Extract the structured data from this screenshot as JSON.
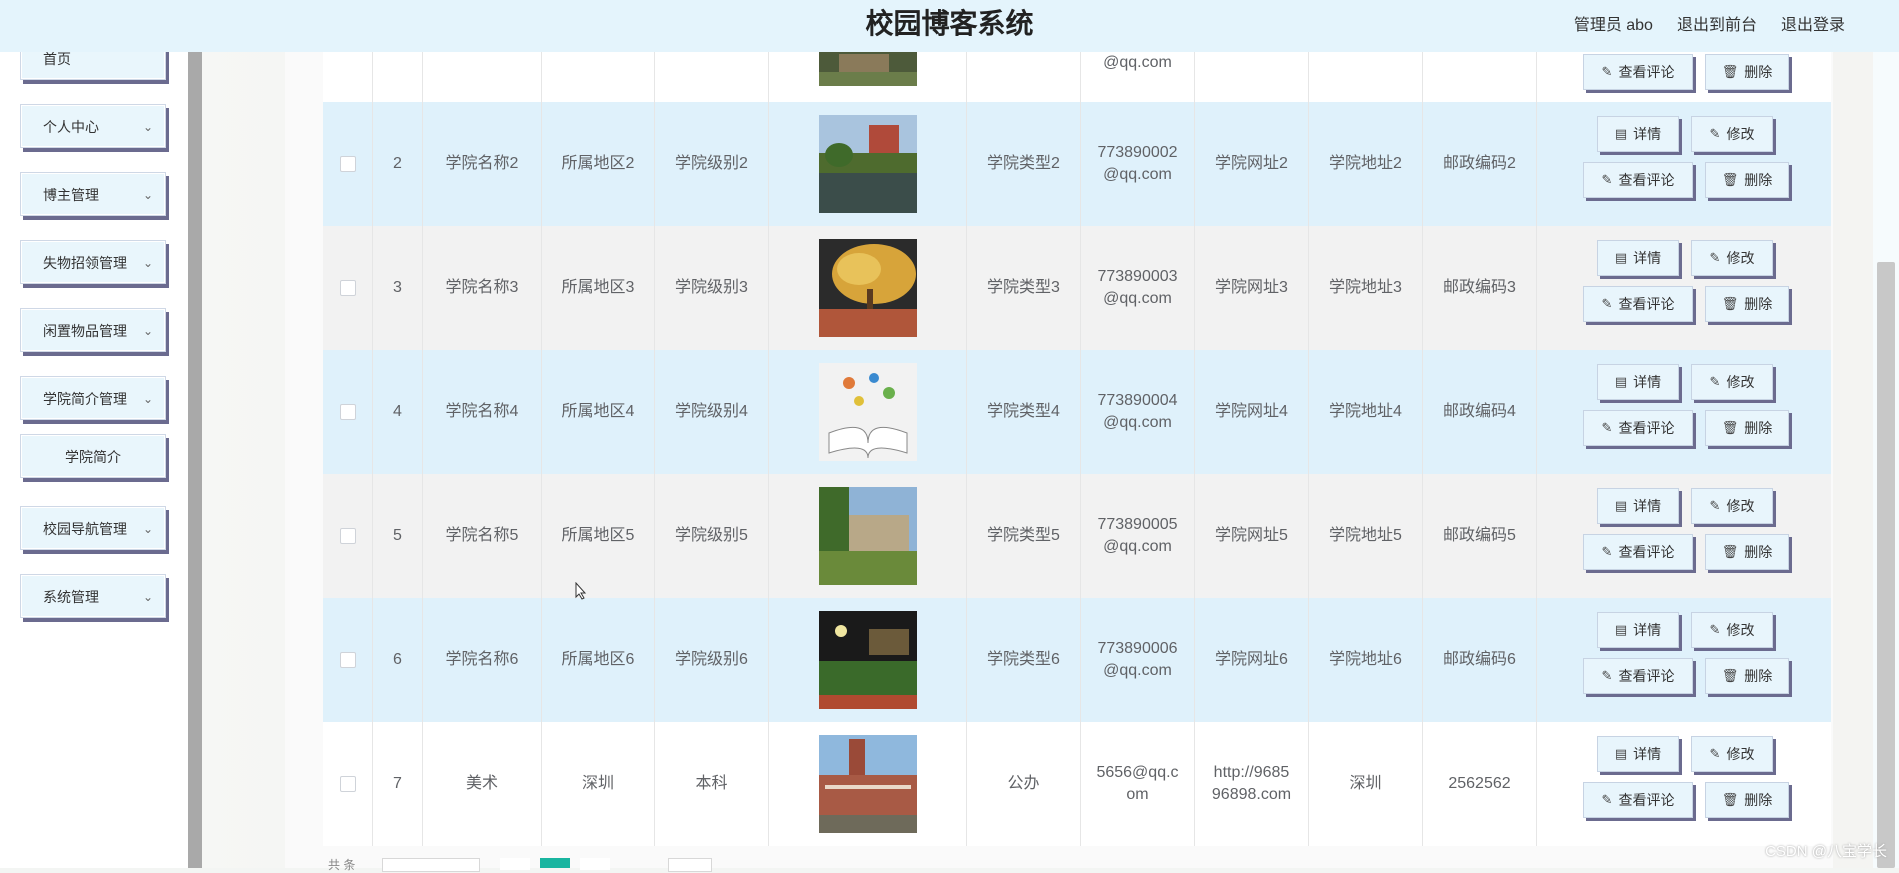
{
  "header": {
    "title": "校园博客系统",
    "admin": "管理员 abo",
    "back_front": "退出到前台",
    "logout": "退出登录"
  },
  "sidebar": {
    "items": [
      {
        "label": "首页"
      },
      {
        "label": "个人中心"
      },
      {
        "label": "博主管理"
      },
      {
        "label": "失物招领管理"
      },
      {
        "label": "闲置物品管理"
      },
      {
        "label": "学院简介管理"
      },
      {
        "label": "学院简介"
      },
      {
        "label": "校园导航管理"
      },
      {
        "label": "系统管理"
      }
    ]
  },
  "table": {
    "buttons": {
      "detail": "详情",
      "edit": "修改",
      "comments": "查看评论",
      "delete": "删除"
    },
    "top_partial": {
      "email": "@qq.com"
    },
    "rows": [
      {
        "no": "2",
        "name": "学院名称2",
        "region": "所属地区2",
        "level": "学院级别2",
        "type": "学院类型2",
        "email1": "773890002",
        "email2": "@qq.com",
        "site1": "学院网址2",
        "site2": "",
        "addr": "学院地址2",
        "zip": "邮政编码2",
        "image": "campus-lake"
      },
      {
        "no": "3",
        "name": "学院名称3",
        "region": "所属地区3",
        "level": "学院级别3",
        "type": "学院类型3",
        "email1": "773890003",
        "email2": "@qq.com",
        "site1": "学院网址3",
        "site2": "",
        "addr": "学院地址3",
        "zip": "邮政编码3",
        "image": "autumn-tree"
      },
      {
        "no": "4",
        "name": "学院名称4",
        "region": "所属地区4",
        "level": "学院级别4",
        "type": "学院类型4",
        "email1": "773890004",
        "email2": "@qq.com",
        "site1": "学院网址4",
        "site2": "",
        "addr": "学院地址4",
        "zip": "邮政编码4",
        "image": "open-book"
      },
      {
        "no": "5",
        "name": "学院名称5",
        "region": "所属地区5",
        "level": "学院级别5",
        "type": "学院类型5",
        "email1": "773890005",
        "email2": "@qq.com",
        "site1": "学院网址5",
        "site2": "",
        "addr": "学院地址5",
        "zip": "邮政编码5",
        "image": "campus-building"
      },
      {
        "no": "6",
        "name": "学院名称6",
        "region": "所属地区6",
        "level": "学院级别6",
        "type": "学院类型6",
        "email1": "773890006",
        "email2": "@qq.com",
        "site1": "学院网址6",
        "site2": "",
        "addr": "学院地址6",
        "zip": "邮政编码6",
        "image": "night-field"
      },
      {
        "no": "7",
        "name": "美术",
        "region": "深圳",
        "level": "本科",
        "type": "公办",
        "email1": "5656@qq.c",
        "email2": "om",
        "site1": "http://9685",
        "site2": "96898.com",
        "addr": "深圳",
        "zip": "2562562",
        "image": "clock-tower"
      }
    ]
  },
  "watermark": "CSDN @八宝学长",
  "colors": {
    "header_bg": "#e4f4fc",
    "row_blue": "#dff1fb",
    "pager_active": "#19b5a0",
    "button_shadow": "#6b6b8f"
  }
}
